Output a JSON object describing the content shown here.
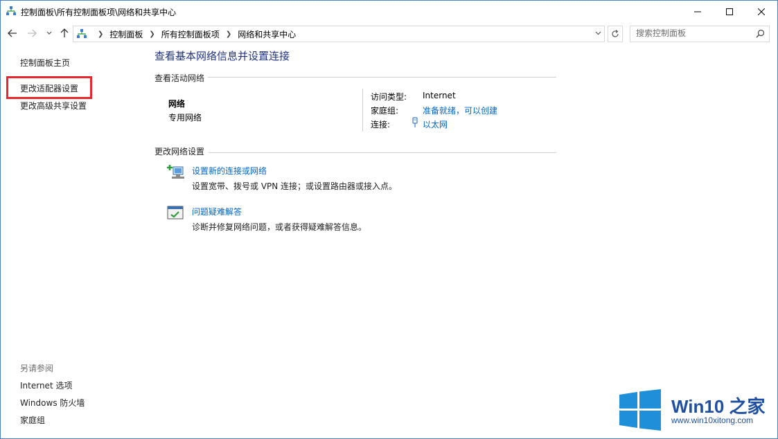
{
  "window": {
    "title": "控制面板\\所有控制面板项\\网络和共享中心",
    "title_icon": "network-center-icon",
    "controls": [
      "minimize-icon",
      "maximize-icon",
      "close-icon"
    ]
  },
  "nav": {
    "breadcrumbs": [
      "控制面板",
      "所有控制面板项",
      "网络和共享中心"
    ],
    "search_placeholder": "搜索控制面板"
  },
  "sidebar": {
    "items": [
      {
        "label": "控制面板主页"
      },
      {
        "label": "更改适配器设置"
      },
      {
        "label": "更改高级共享设置"
      }
    ],
    "see_also_title": "另请参阅",
    "see_also": [
      {
        "label": "Internet 选项"
      },
      {
        "label": "Windows 防火墙"
      },
      {
        "label": "家庭组"
      }
    ]
  },
  "main": {
    "title": "查看基本网络信息并设置连接",
    "active_section": "查看活动网络",
    "network": {
      "name": "网络",
      "type": "专用网络",
      "access_type_label": "访问类型:",
      "access_type_value": "Internet",
      "homegroup_label": "家庭组:",
      "homegroup_value": "准备就绪，可以创建",
      "connections_label": "连接:",
      "connections_value": "以太网"
    },
    "change_section": "更改网络设置",
    "tasks": [
      {
        "icon": "new-connection-icon",
        "link": "设置新的连接或网络",
        "desc": "设置宽带、拨号或 VPN 连接；或设置路由器或接入点。"
      },
      {
        "icon": "troubleshoot-icon",
        "link": "问题疑难解答",
        "desc": "诊断并修复网络问题，或者获得疑难解答信息。"
      }
    ]
  },
  "watermark": {
    "brand": "Win10 之家",
    "url": "www.win10xitong.com"
  },
  "colors": {
    "title_blue": "#1e3287",
    "link_blue": "#0066cc",
    "highlight_red": "#e8262d",
    "watermark_blue": "#1e8fd8"
  }
}
